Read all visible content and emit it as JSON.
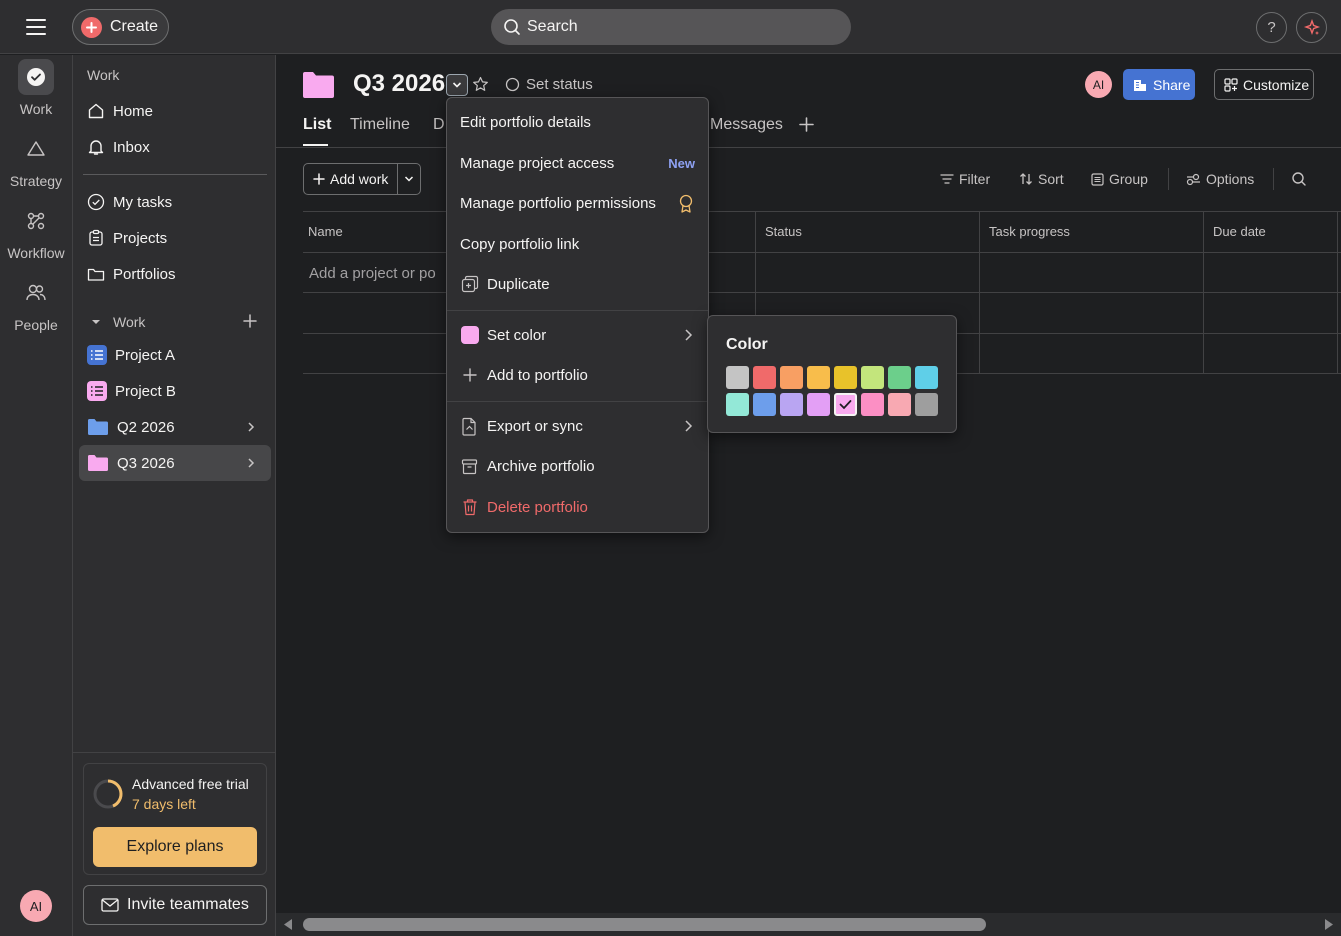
{
  "topbar": {
    "create_label": "Create",
    "search_placeholder": "Search",
    "help_label": "?"
  },
  "rail": {
    "items": [
      {
        "label": "Work",
        "icon": "check-circle-icon"
      },
      {
        "label": "Strategy",
        "icon": "triangle-icon"
      },
      {
        "label": "Workflow",
        "icon": "workflow-icon"
      },
      {
        "label": "People",
        "icon": "people-icon"
      }
    ],
    "avatar": "AI"
  },
  "sidebar": {
    "heading": "Work",
    "nav": [
      {
        "label": "Home",
        "icon": "home-icon"
      },
      {
        "label": "Inbox",
        "icon": "bell-icon"
      }
    ],
    "nav2": [
      {
        "label": "My tasks",
        "icon": "check-circle-icon"
      },
      {
        "label": "Projects",
        "icon": "clipboard-icon"
      },
      {
        "label": "Portfolios",
        "icon": "folder-icon"
      }
    ],
    "section_label": "Work",
    "projects": [
      {
        "label": "Project A",
        "color": "#4573d2"
      },
      {
        "label": "Project B",
        "color": "#f9aaef"
      },
      {
        "label": "Q2 2026",
        "color": "#6d9eeb"
      },
      {
        "label": "Q3 2026",
        "color": "#f9aaef"
      }
    ],
    "trial": {
      "title": "Advanced free trial",
      "days_left": "7 days left",
      "cta": "Explore plans"
    },
    "invite_label": "Invite teammates"
  },
  "header": {
    "title": "Q3 2026",
    "set_status": "Set status",
    "avatar": "AI",
    "share_label": "Share",
    "customize_label": "Customize",
    "tabs": [
      "List",
      "Timeline",
      "D",
      "Messages"
    ]
  },
  "toolbar": {
    "add_work": "Add work",
    "filter": "Filter",
    "sort": "Sort",
    "group": "Group",
    "options": "Options"
  },
  "table": {
    "columns": [
      "Name",
      "Status",
      "Task progress",
      "Due date"
    ],
    "add_row_placeholder": "Add a project or po"
  },
  "menu": {
    "items": [
      {
        "label": "Edit portfolio details"
      },
      {
        "label": "Manage project access",
        "badge": "New"
      },
      {
        "label": "Manage portfolio permissions"
      },
      {
        "label": "Copy portfolio link"
      },
      {
        "label": "Duplicate"
      },
      {
        "label": "Set color"
      },
      {
        "label": "Add to portfolio"
      },
      {
        "label": "Export or sync"
      },
      {
        "label": "Archive portfolio"
      },
      {
        "label": "Delete portfolio"
      }
    ]
  },
  "color_picker": {
    "title": "Color",
    "colors": [
      "#c4c4c4",
      "#f06a6a",
      "#f89f63",
      "#f8bd4b",
      "#e8c22a",
      "#c3e57c",
      "#6ccf8b",
      "#5fcfe8",
      "#93e8d7",
      "#6d9eeb",
      "#b9a5f2",
      "#e39ff5",
      "#f9aaef",
      "#fc8fc4",
      "#f8a9b2",
      "#9e9e9e"
    ],
    "selected_index": 12
  }
}
